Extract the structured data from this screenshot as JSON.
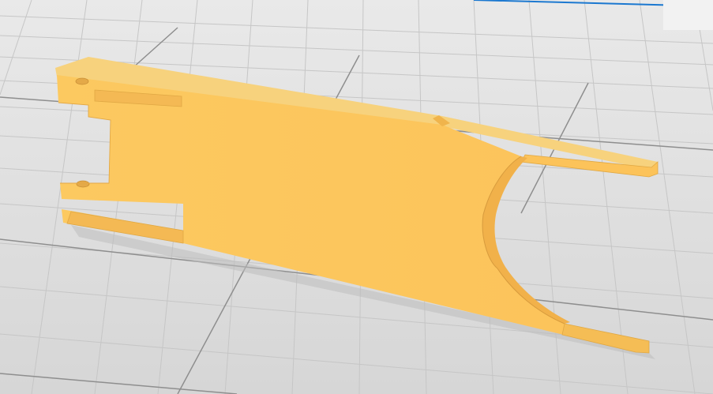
{
  "viewport": {
    "background": "#dcdcdc",
    "grid_minor_color": "#c4c4c4",
    "grid_major_color": "#8a8a8a",
    "part_color": "#fcc35a",
    "part_shade": "#f1b14a",
    "part_top": "#f7d27d",
    "part_edge": "#e0a844",
    "build_plate_edge": "#1b78d0"
  },
  "model": {
    "icon": "3d-part-icon"
  }
}
